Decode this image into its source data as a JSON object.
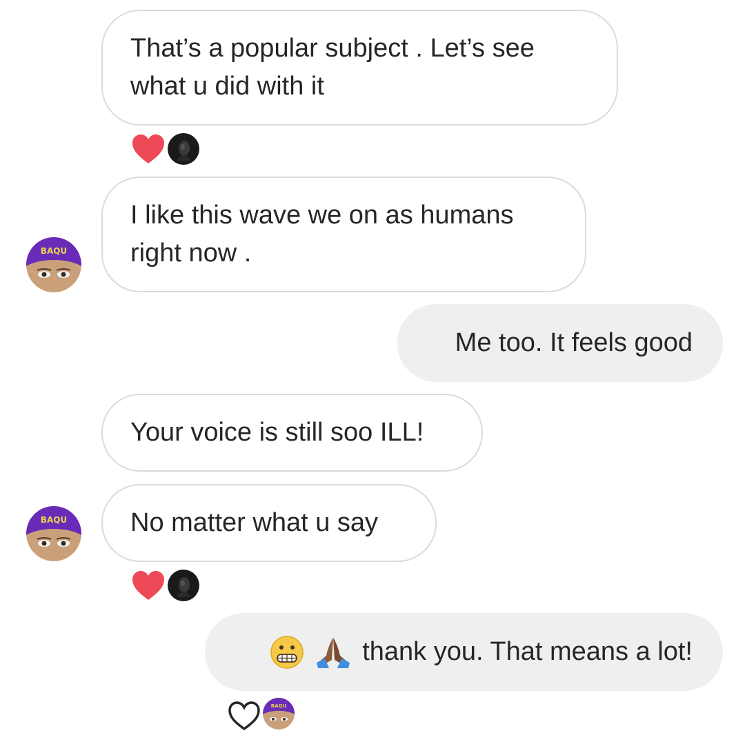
{
  "conversation": {
    "messages": [
      {
        "id": "m1",
        "direction": "incoming",
        "text": "That’s a popular subject . Let’s see\nwhat u did with it"
      },
      {
        "id": "m2",
        "direction": "incoming",
        "text": "I like this wave we on as humans\nright now ."
      },
      {
        "id": "m3",
        "direction": "outgoing",
        "text": "Me too. It feels good"
      },
      {
        "id": "m4",
        "direction": "incoming",
        "text": "Your voice is still soo ILL!"
      },
      {
        "id": "m5",
        "direction": "incoming",
        "text": "No matter what u say"
      },
      {
        "id": "m6",
        "direction": "outgoing",
        "text": "thank you. That means a lot!",
        "emojis": [
          "grimacing-face-emoji",
          "folded-hands-emoji"
        ]
      }
    ],
    "reactions": [
      {
        "after_message": "m1",
        "icon": "heart-filled-icon",
        "color": "#ed4956"
      },
      {
        "after_message": "m5",
        "icon": "heart-filled-icon",
        "color": "#ed4956"
      },
      {
        "after_message": "m6",
        "icon": "heart-outline-icon",
        "color": "#262626"
      }
    ]
  },
  "colors": {
    "incoming_border": "#dbdbdb",
    "outgoing_background": "#efefef",
    "text": "#262626",
    "heart_red": "#ed4956",
    "avatar_purple": "#6a2bb8"
  }
}
